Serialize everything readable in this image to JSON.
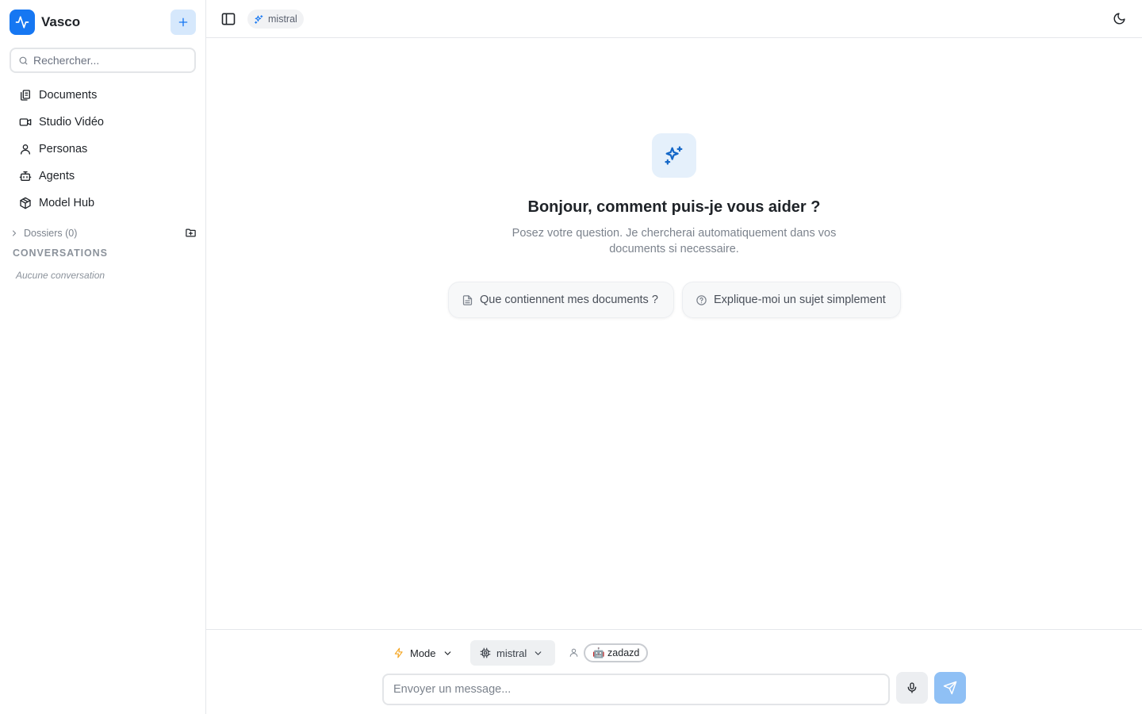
{
  "app": {
    "name": "Vasco"
  },
  "sidebar": {
    "search_placeholder": "Rechercher...",
    "items": [
      {
        "label": "Documents",
        "icon": "documents-icon"
      },
      {
        "label": "Studio Vidéo",
        "icon": "video-icon"
      },
      {
        "label": "Personas",
        "icon": "user-icon"
      },
      {
        "label": "Agents",
        "icon": "bot-icon"
      },
      {
        "label": "Model Hub",
        "icon": "package-icon"
      }
    ],
    "folders_label": "Dossiers (0)",
    "conversations_title": "CONVERSATIONS",
    "conversations_empty": "Aucune conversation"
  },
  "topbar": {
    "model": "mistral"
  },
  "hero": {
    "title": "Bonjour, comment puis-je vous aider ?",
    "subtitle": "Posez votre question. Je chercherai automatiquement dans vos documents si necessaire."
  },
  "suggestions": [
    {
      "label": "Que contiennent mes documents ?",
      "icon": "file-icon"
    },
    {
      "label": "Explique-moi un sujet simplement",
      "icon": "help-circle-icon"
    }
  ],
  "composer": {
    "mode_label": "Mode",
    "model_label": "mistral",
    "persona_label": "🤖 zadazd",
    "input_placeholder": "Envoyer un message..."
  },
  "colors": {
    "accent": "#1677f2",
    "accent_soft": "#d6e8fc",
    "send_button": "#8fc0f5",
    "mode_icon": "#f5a623"
  }
}
